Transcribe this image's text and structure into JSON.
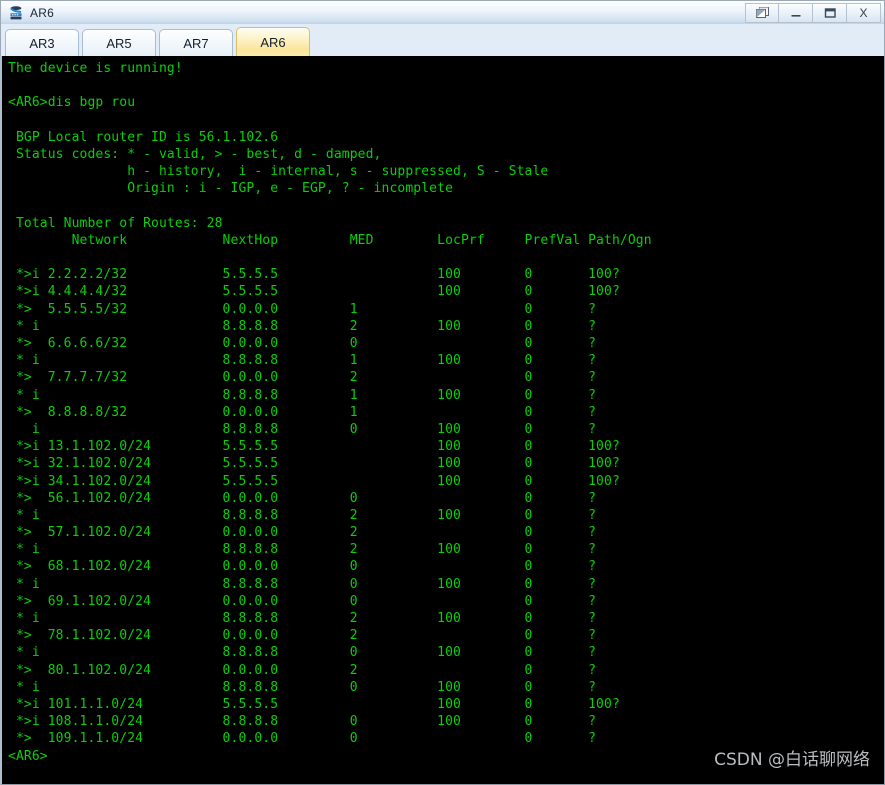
{
  "window": {
    "title": "AR6",
    "icon": "router-device-icon",
    "buttons": [
      {
        "name": "restore-window-button",
        "icon": "restore-icon",
        "label": "❐"
      },
      {
        "name": "minimize-window-button",
        "icon": "minimize-icon",
        "label": "—"
      },
      {
        "name": "maximize-window-button",
        "icon": "maximize-icon",
        "label": "□"
      },
      {
        "name": "close-window-button",
        "icon": "close-icon",
        "label": "X"
      }
    ]
  },
  "tabs": [
    {
      "label": "AR3",
      "active": false
    },
    {
      "label": "AR5",
      "active": false
    },
    {
      "label": "AR7",
      "active": false
    },
    {
      "label": "AR6",
      "active": true
    }
  ],
  "terminal": {
    "foreground_color": "#0ACF0A",
    "background_color": "#000000",
    "banner": "The device is running!",
    "prompt_line": "<AR6>dis bgp rou",
    "router_id_line": " BGP Local router ID is 56.1.102.6",
    "status_codes_line": " Status codes: * - valid, > - best, d - damped,",
    "status_codes_line2": "               h - history,  i - internal, s - suppressed, S - Stale",
    "origin_line": "               Origin : i - IGP, e - EGP, ? - incomplete",
    "total_routes_line": " Total Number of Routes: 28",
    "final_prompt": "<AR6>",
    "columns": {
      "network": "Network",
      "nexthop": "NextHop",
      "med": "MED",
      "locprf": "LocPrf",
      "prefval": "PrefVal",
      "path_ogn": "Path/Ogn"
    },
    "header_line": "        Network            NextHop         MED        LocPrf     PrefVal Path/Ogn",
    "routes": [
      {
        "status": "*>i",
        "network": "2.2.2.2/32",
        "nexthop": "5.5.5.5",
        "med": "",
        "locprf": "100",
        "prefval": "0",
        "path": "100?"
      },
      {
        "status": "*>i",
        "network": "4.4.4.4/32",
        "nexthop": "5.5.5.5",
        "med": "",
        "locprf": "100",
        "prefval": "0",
        "path": "100?"
      },
      {
        "status": "*>",
        "network": "5.5.5.5/32",
        "nexthop": "0.0.0.0",
        "med": "1",
        "locprf": "",
        "prefval": "0",
        "path": "?"
      },
      {
        "status": "* i",
        "network": "",
        "nexthop": "8.8.8.8",
        "med": "2",
        "locprf": "100",
        "prefval": "0",
        "path": "?"
      },
      {
        "status": "*>",
        "network": "6.6.6.6/32",
        "nexthop": "0.0.0.0",
        "med": "0",
        "locprf": "",
        "prefval": "0",
        "path": "?"
      },
      {
        "status": "* i",
        "network": "",
        "nexthop": "8.8.8.8",
        "med": "1",
        "locprf": "100",
        "prefval": "0",
        "path": "?"
      },
      {
        "status": "*>",
        "network": "7.7.7.7/32",
        "nexthop": "0.0.0.0",
        "med": "2",
        "locprf": "",
        "prefval": "0",
        "path": "?"
      },
      {
        "status": "* i",
        "network": "",
        "nexthop": "8.8.8.8",
        "med": "1",
        "locprf": "100",
        "prefval": "0",
        "path": "?"
      },
      {
        "status": "*>",
        "network": "8.8.8.8/32",
        "nexthop": "0.0.0.0",
        "med": "1",
        "locprf": "",
        "prefval": "0",
        "path": "?"
      },
      {
        "status": "  i",
        "network": "",
        "nexthop": "8.8.8.8",
        "med": "0",
        "locprf": "100",
        "prefval": "0",
        "path": "?"
      },
      {
        "status": "*>i",
        "network": "13.1.102.0/24",
        "nexthop": "5.5.5.5",
        "med": "",
        "locprf": "100",
        "prefval": "0",
        "path": "100?"
      },
      {
        "status": "*>i",
        "network": "32.1.102.0/24",
        "nexthop": "5.5.5.5",
        "med": "",
        "locprf": "100",
        "prefval": "0",
        "path": "100?"
      },
      {
        "status": "*>i",
        "network": "34.1.102.0/24",
        "nexthop": "5.5.5.5",
        "med": "",
        "locprf": "100",
        "prefval": "0",
        "path": "100?"
      },
      {
        "status": "*>",
        "network": "56.1.102.0/24",
        "nexthop": "0.0.0.0",
        "med": "0",
        "locprf": "",
        "prefval": "0",
        "path": "?"
      },
      {
        "status": "* i",
        "network": "",
        "nexthop": "8.8.8.8",
        "med": "2",
        "locprf": "100",
        "prefval": "0",
        "path": "?"
      },
      {
        "status": "*>",
        "network": "57.1.102.0/24",
        "nexthop": "0.0.0.0",
        "med": "2",
        "locprf": "",
        "prefval": "0",
        "path": "?"
      },
      {
        "status": "* i",
        "network": "",
        "nexthop": "8.8.8.8",
        "med": "2",
        "locprf": "100",
        "prefval": "0",
        "path": "?"
      },
      {
        "status": "*>",
        "network": "68.1.102.0/24",
        "nexthop": "0.0.0.0",
        "med": "0",
        "locprf": "",
        "prefval": "0",
        "path": "?"
      },
      {
        "status": "* i",
        "network": "",
        "nexthop": "8.8.8.8",
        "med": "0",
        "locprf": "100",
        "prefval": "0",
        "path": "?"
      },
      {
        "status": "*>",
        "network": "69.1.102.0/24",
        "nexthop": "0.0.0.0",
        "med": "0",
        "locprf": "",
        "prefval": "0",
        "path": "?"
      },
      {
        "status": "* i",
        "network": "",
        "nexthop": "8.8.8.8",
        "med": "2",
        "locprf": "100",
        "prefval": "0",
        "path": "?"
      },
      {
        "status": "*>",
        "network": "78.1.102.0/24",
        "nexthop": "0.0.0.0",
        "med": "2",
        "locprf": "",
        "prefval": "0",
        "path": "?"
      },
      {
        "status": "* i",
        "network": "",
        "nexthop": "8.8.8.8",
        "med": "0",
        "locprf": "100",
        "prefval": "0",
        "path": "?"
      },
      {
        "status": "*>",
        "network": "80.1.102.0/24",
        "nexthop": "0.0.0.0",
        "med": "2",
        "locprf": "",
        "prefval": "0",
        "path": "?"
      },
      {
        "status": "* i",
        "network": "",
        "nexthop": "8.8.8.8",
        "med": "0",
        "locprf": "100",
        "prefval": "0",
        "path": "?"
      },
      {
        "status": "*>i",
        "network": "101.1.1.0/24",
        "nexthop": "5.5.5.5",
        "med": "",
        "locprf": "100",
        "prefval": "0",
        "path": "100?"
      },
      {
        "status": "*>i",
        "network": "108.1.1.0/24",
        "nexthop": "8.8.8.8",
        "med": "0",
        "locprf": "100",
        "prefval": "0",
        "path": "?"
      },
      {
        "status": "*>",
        "network": "109.1.1.0/24",
        "nexthop": "0.0.0.0",
        "med": "0",
        "locprf": "",
        "prefval": "0",
        "path": "?"
      }
    ]
  },
  "watermark": "CSDN @白话聊网络"
}
